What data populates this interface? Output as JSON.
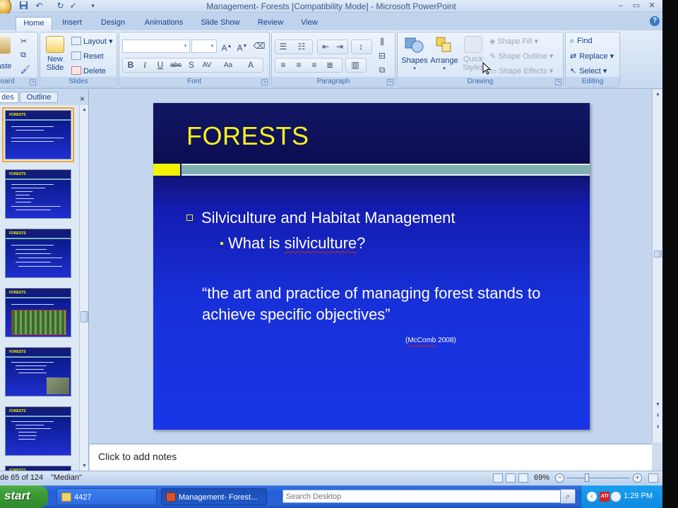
{
  "window": {
    "title": "Management- Forests [Compatibility Mode] - Microsoft PowerPoint",
    "controls": {
      "minimize": "–",
      "restore": "▭",
      "close": "✕"
    }
  },
  "ribbon_tabs": [
    "Home",
    "Insert",
    "Design",
    "Animations",
    "Slide Show",
    "Review",
    "View"
  ],
  "ribbon": {
    "clipboard": {
      "label": "board",
      "paste": "aste"
    },
    "slides": {
      "label": "Slides",
      "new_slide": "New\nSlide",
      "layout": "Layout",
      "reset": "Reset",
      "delete": "Delete"
    },
    "font": {
      "label": "Font"
    },
    "paragraph": {
      "label": "Paragraph"
    },
    "drawing": {
      "label": "Drawing",
      "shapes": "Shapes",
      "arrange": "Arrange",
      "quick_styles": "Quick\nStyles",
      "shape_fill": "Shape Fill",
      "shape_outline": "Shape Outline",
      "shape_effects": "Shape Effects"
    },
    "editing": {
      "label": "Editing",
      "find": "Find",
      "replace": "Replace",
      "select": "Select"
    }
  },
  "panel": {
    "tab_slides": "des",
    "tab_outline": "Outline",
    "close": "×",
    "thumb_title": "FORESTS"
  },
  "slide": {
    "title": "FORESTS",
    "bullet1": "Silviculture and Habitat Management",
    "bullet2_prefix": "What is ",
    "bullet2_word": "silviculture",
    "bullet2_suffix": "?",
    "quote": "“the art and practice of managing forest stands to achieve specific objectives”",
    "citation_open": "(",
    "citation_name": "McComb",
    "citation_year": " 2008)"
  },
  "notes": {
    "placeholder": "Click to add notes"
  },
  "status": {
    "slide_counter": "de 65 of 124",
    "theme": "\"Median\"",
    "zoom": "69%",
    "zoom_out": "−",
    "zoom_in": "+"
  },
  "taskbar": {
    "start": "start",
    "items": [
      {
        "label": "4427"
      },
      {
        "label": "Management- Forest..."
      }
    ],
    "search_placeholder": "Search Desktop",
    "clock": "1:29 PM"
  },
  "colors": {
    "slide_title": "#f7f21a",
    "slide_accent": "#7db1b3",
    "slide_bg": "#1830d8"
  }
}
